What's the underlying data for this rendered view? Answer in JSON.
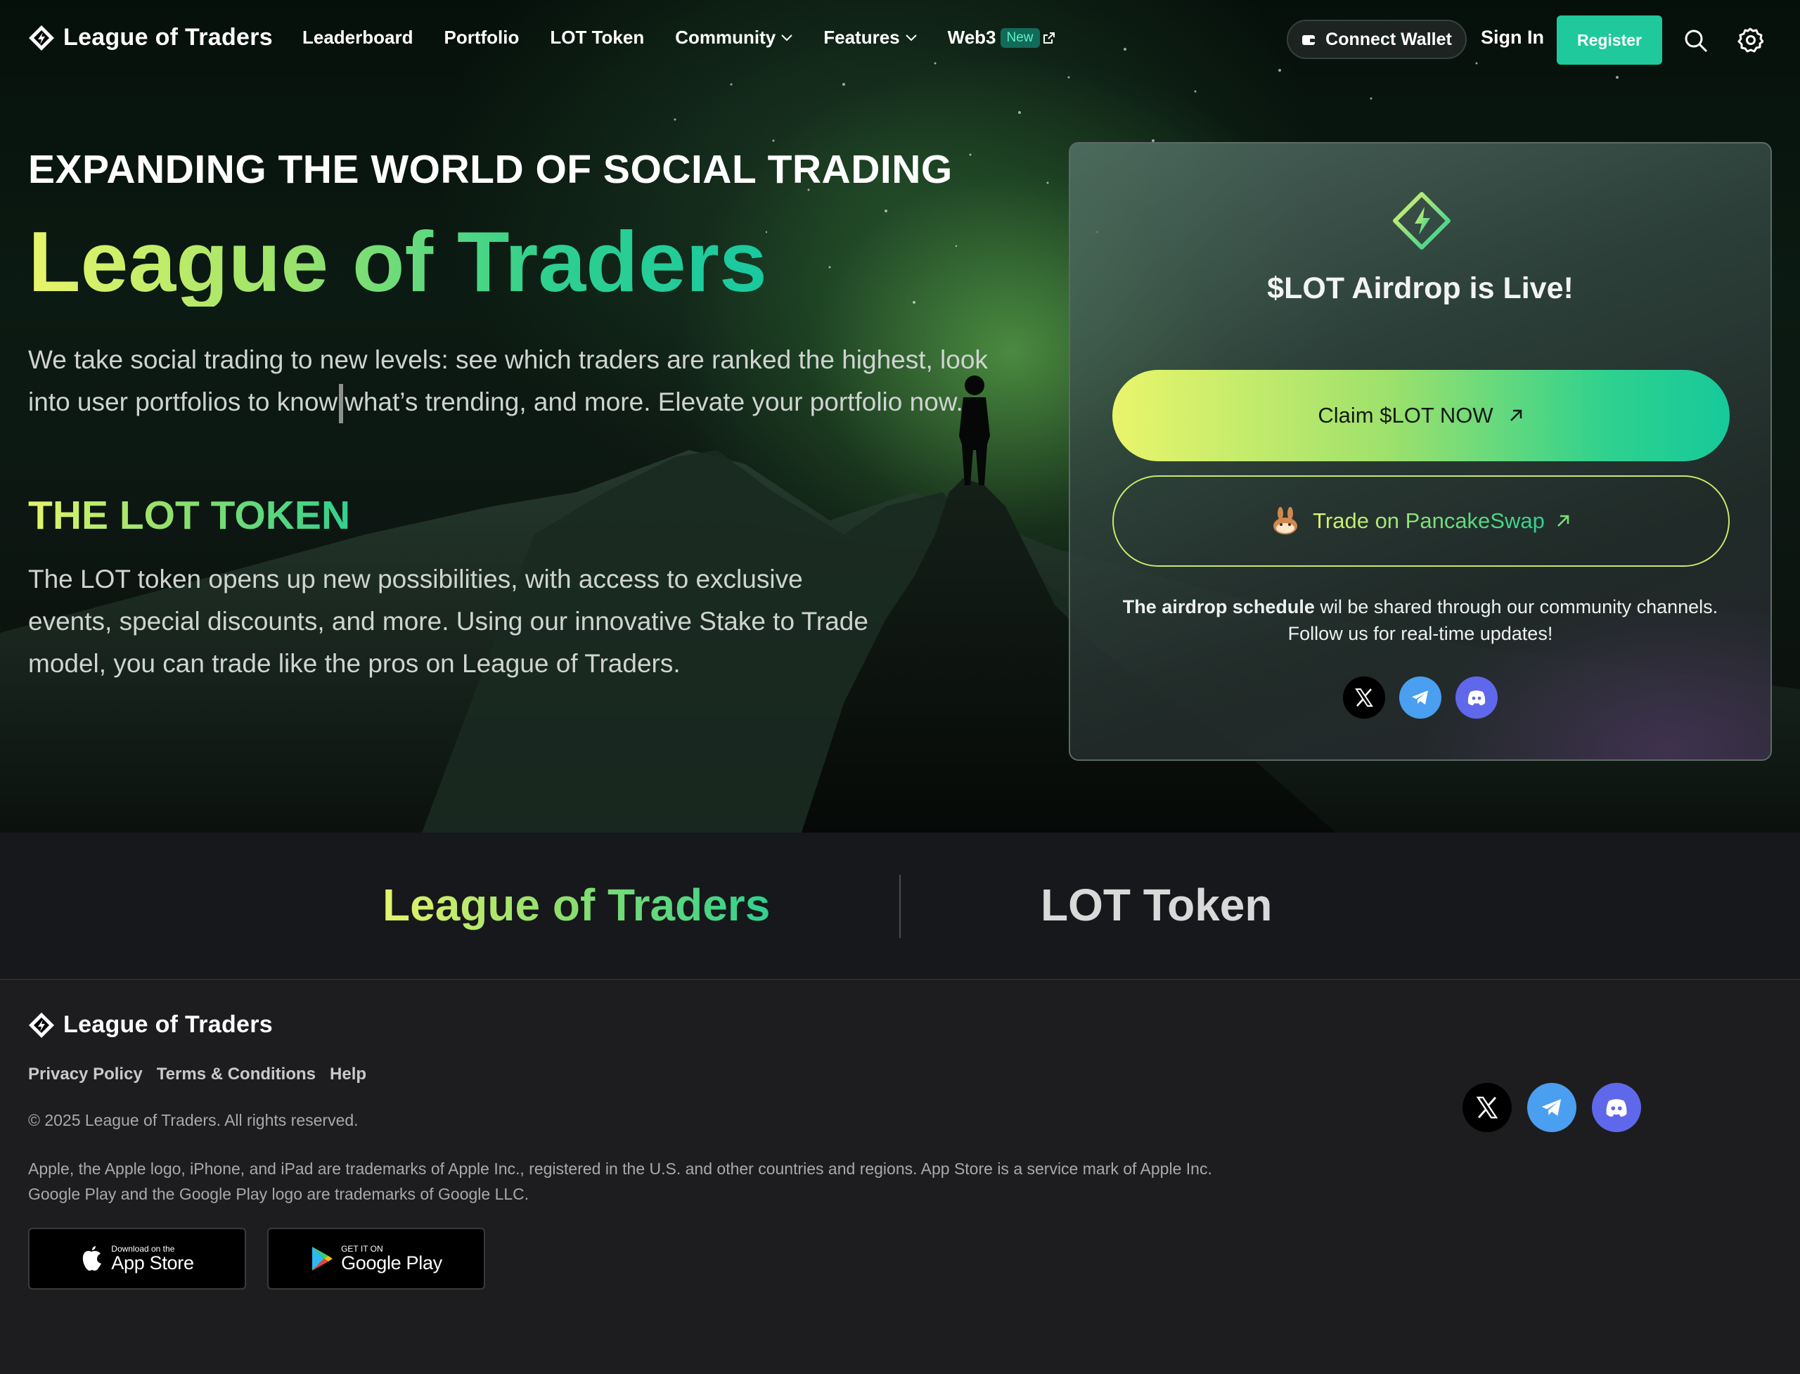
{
  "brand": {
    "name": "League of Traders"
  },
  "nav": {
    "links": [
      {
        "label": "Leaderboard"
      },
      {
        "label": "Portfolio"
      },
      {
        "label": "LOT Token"
      },
      {
        "label": "Community"
      },
      {
        "label": "Features"
      },
      {
        "label": "Web3",
        "badge": "New"
      }
    ],
    "connect_wallet": "Connect Wallet",
    "sign_in": "Sign In",
    "register": "Register"
  },
  "hero": {
    "kicker": "EXPANDING THE WORLD OF SOCIAL TRADING",
    "title": "League of Traders",
    "description_part1": "We take social trading to new levels: see which traders are ranked the highest, look into user portfolios to know",
    "description_part2": "what’s trending, and more. Elevate your portfolio now.",
    "lot_heading": "THE LOT TOKEN",
    "lot_description": "The LOT token opens up new possibilities, with access to exclusive events, special discounts, and more. Using our innovative Stake to Trade model, you can trade like the pros on League of Traders."
  },
  "airdrop_card": {
    "title": "$LOT Airdrop is Live!",
    "claim_button": "Claim $LOT NOW",
    "trade_button": "Trade on PancakeSwap",
    "note_bold": "The airdrop schedule",
    "note_rest_line1": "wil be shared through our community channels.",
    "note_line2": "Follow us for real-time updates!"
  },
  "tabs": [
    {
      "label": "League of Traders",
      "active": true
    },
    {
      "label": "LOT Token",
      "active": false
    }
  ],
  "footer": {
    "links": [
      "Privacy Policy",
      "Terms & Conditions",
      "Help"
    ],
    "copyright": "© 2025 League of Traders. All rights reserved.",
    "legal_line1": "Apple, the Apple logo, iPhone, and iPad are trademarks of Apple Inc., registered in the U.S. and other countries and regions. App Store is a service mark of Apple Inc.",
    "legal_line2": "Google Play and the Google Play logo are trademarks of Google LLC.",
    "app_store": {
      "small": "Download on the",
      "big": "App Store"
    },
    "google_play": {
      "small": "GET IT ON",
      "big": "Google Play"
    }
  },
  "icons": {
    "social": [
      "x-icon",
      "telegram-icon",
      "discord-icon"
    ],
    "nav": [
      "search-icon",
      "gear-icon",
      "wallet-icon",
      "external-link-icon",
      "chevron-down-icon"
    ]
  },
  "colors": {
    "accent": "#1fc99b",
    "gradient_start": "#e8f56a",
    "gradient_end": "#19c9a0",
    "telegram": "#4a9ff0",
    "discord": "#5f68ea"
  }
}
